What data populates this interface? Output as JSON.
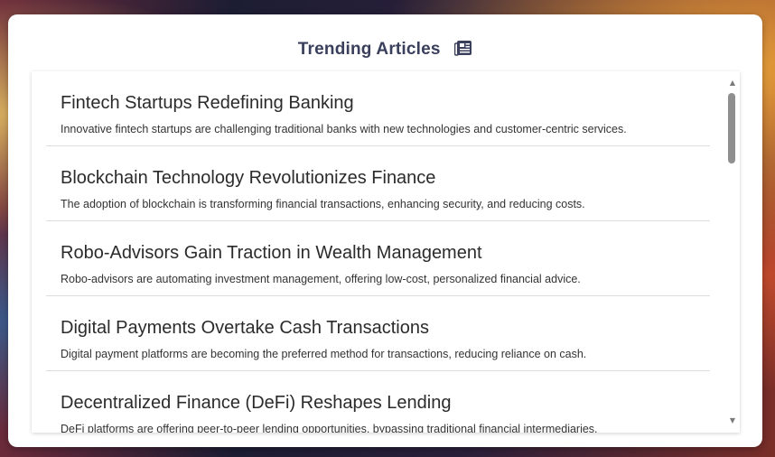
{
  "header": {
    "title": "Trending Articles",
    "icon": "newspaper-icon"
  },
  "articles": [
    {
      "title": "Fintech Startups Redefining Banking",
      "description": "Innovative fintech startups are challenging traditional banks with new technologies and customer-centric services."
    },
    {
      "title": "Blockchain Technology Revolutionizes Finance",
      "description": "The adoption of blockchain is transforming financial transactions, enhancing security, and reducing costs."
    },
    {
      "title": "Robo-Advisors Gain Traction in Wealth Management",
      "description": "Robo-advisors are automating investment management, offering low-cost, personalized financial advice."
    },
    {
      "title": "Digital Payments Overtake Cash Transactions",
      "description": "Digital payment platforms are becoming the preferred method for transactions, reducing reliance on cash."
    },
    {
      "title": "Decentralized Finance (DeFi) Reshapes Lending",
      "description": "DeFi platforms are offering peer-to-peer lending opportunities, bypassing traditional financial intermediaries."
    }
  ],
  "scrollbar": {
    "up_icon": "triangle-up-icon",
    "down_icon": "triangle-down-icon"
  },
  "colors": {
    "title": "#3a3f5c",
    "article_title": "#2b2b2b",
    "card_background": "#ffffff"
  }
}
